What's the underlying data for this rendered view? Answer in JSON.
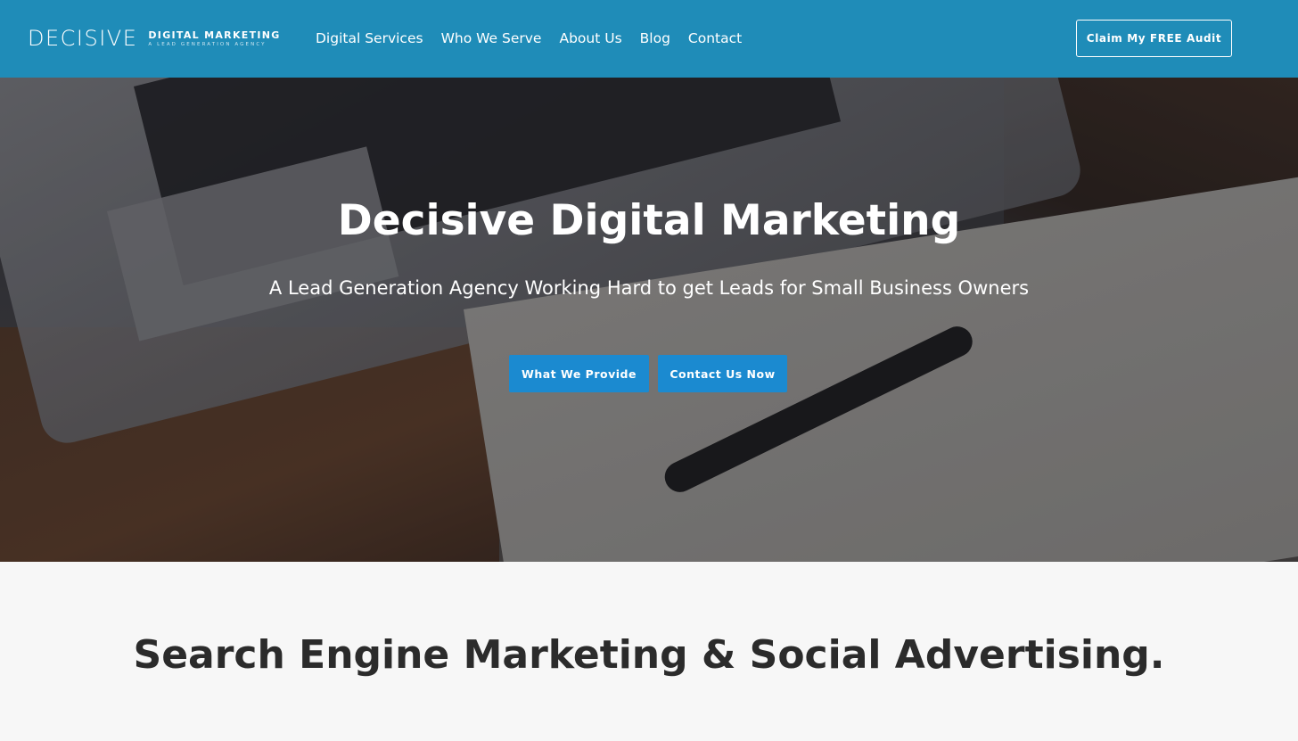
{
  "header": {
    "logo_main": "DECISIVE",
    "logo_sub": "DIGITAL MARKETING",
    "logo_tagline": "A LEAD GENERATION AGENCY",
    "nav": [
      {
        "label": "Digital Services"
      },
      {
        "label": "Who We Serve"
      },
      {
        "label": "About Us"
      },
      {
        "label": "Blog"
      },
      {
        "label": "Contact"
      }
    ],
    "cta_label": "Claim My FREE Audit"
  },
  "hero": {
    "title": "Decisive Digital Marketing",
    "subtitle": "A Lead Generation Agency Working Hard to get Leads for Small Business Owners",
    "primary_button": "What We Provide",
    "secondary_button": "Contact Us Now"
  },
  "section": {
    "title": "Search Engine Marketing & Social Advertising."
  },
  "colors": {
    "header_bg": "#1f8cb8",
    "button_blue": "#1b8ad0",
    "section_bg": "#f7f7f7",
    "heading_text": "#2b2b2b"
  }
}
